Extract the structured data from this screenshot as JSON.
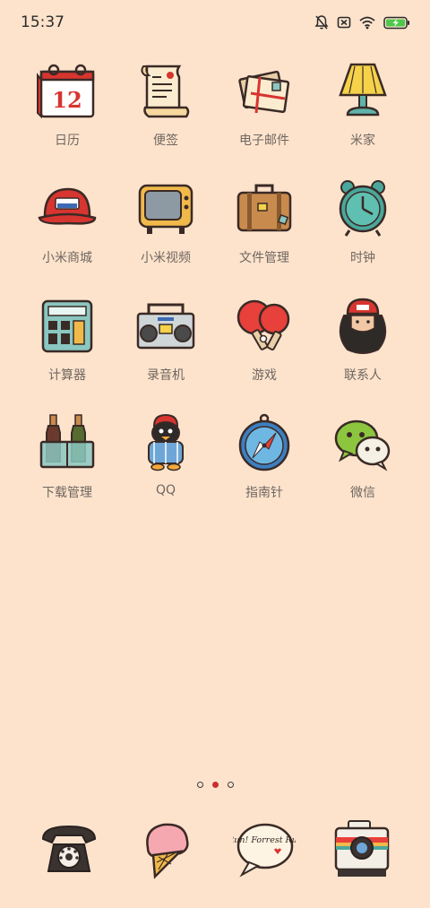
{
  "status_bar": {
    "time": "15:37",
    "icons": [
      "bell-off-icon",
      "sim-off-icon",
      "wifi-icon",
      "battery-charging-icon"
    ]
  },
  "apps": [
    {
      "label": "日历",
      "icon": "calendar-icon",
      "date": "12"
    },
    {
      "label": "便签",
      "icon": "notes-scroll-icon"
    },
    {
      "label": "电子邮件",
      "icon": "email-letters-icon"
    },
    {
      "label": "米家",
      "icon": "lamp-icon"
    },
    {
      "label": "小米商城",
      "icon": "cap-icon"
    },
    {
      "label": "小米视频",
      "icon": "tv-icon"
    },
    {
      "label": "文件管理",
      "icon": "suitcase-icon"
    },
    {
      "label": "时钟",
      "icon": "alarm-clock-icon"
    },
    {
      "label": "计算器",
      "icon": "calculator-icon"
    },
    {
      "label": "录音机",
      "icon": "boombox-icon"
    },
    {
      "label": "游戏",
      "icon": "ping-pong-icon"
    },
    {
      "label": "联系人",
      "icon": "bearded-man-icon"
    },
    {
      "label": "下载管理",
      "icon": "bottles-icon"
    },
    {
      "label": "QQ",
      "icon": "penguin-icon"
    },
    {
      "label": "指南针",
      "icon": "compass-icon"
    },
    {
      "label": "微信",
      "icon": "chat-bubbles-icon"
    }
  ],
  "page_indicator": {
    "count": 3,
    "active": 2
  },
  "dock": [
    {
      "icon": "rotary-phone-icon"
    },
    {
      "icon": "ice-cream-icon"
    },
    {
      "icon": "speech-bubble-icon",
      "text": "Run! Forrest Run"
    },
    {
      "icon": "camera-icon"
    }
  ],
  "colors": {
    "background": "#fde3cc",
    "label": "#6f6660",
    "accent_red": "#c7302e"
  }
}
